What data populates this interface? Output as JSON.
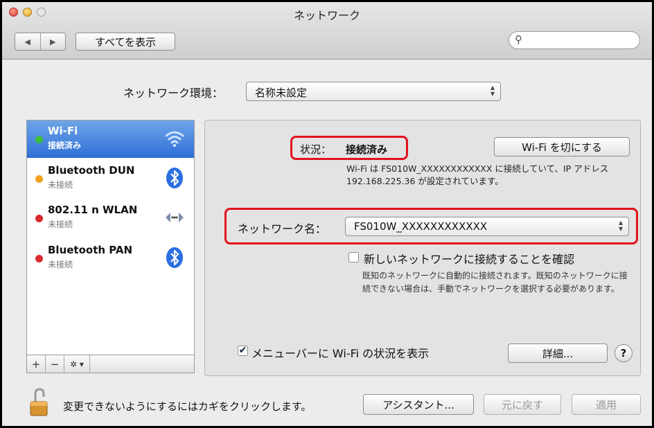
{
  "window": {
    "title": "ネットワーク"
  },
  "toolbar": {
    "back_icon": "back-arrow-icon",
    "forward_icon": "forward-arrow-icon",
    "show_all": "すべてを表示",
    "search_placeholder": "",
    "search_icon": "magnifier-icon"
  },
  "location": {
    "label": "ネットワーク環境：",
    "value": "名称未設定"
  },
  "services": [
    {
      "name": "Wi-Fi",
      "status": "接続済み",
      "dot": "#3cbd3c",
      "icon": "wifi-icon",
      "selected": true
    },
    {
      "name": "Bluetooth DUN",
      "status": "未接続",
      "dot": "#f0a21e",
      "icon": "bluetooth-icon"
    },
    {
      "name": "802.11 n WLAN",
      "status": "未接続",
      "dot": "#d92b2b",
      "icon": "ethernet-arrows-icon"
    },
    {
      "name": "Bluetooth PAN",
      "status": "未接続",
      "dot": "#d92b2b",
      "icon": "bluetooth-icon"
    }
  ],
  "sidebar_controls": {
    "add": "+",
    "remove": "−",
    "gear": "✲ ▾"
  },
  "detail": {
    "status_label": "状況：",
    "status_value": "接続済み",
    "wifi_off_button": "Wi-Fi を切にする",
    "status_desc": "Wi-Fi は FS010W_XXXXXXXXXXXX に接続していて、IP アドレス 192.168.225.36 が設定されています。",
    "network_name_label": "ネットワーク名：",
    "network_name_value": "FS010W_XXXXXXXXXXXX",
    "ask_join_label": "新しいネットワークに接続することを確認",
    "ask_join_checked": false,
    "ask_join_desc": "既知のネットワークに自動的に接続されます。既知のネットワークに接続できない場合は、手動でネットワークを選択する必要があります。",
    "menu_status_label": "メニューバーに Wi-Fi の状況を表示",
    "menu_status_checked": true,
    "advanced_button": "詳細...",
    "help_button": "?"
  },
  "footer": {
    "lock_text": "変更できないようにするにはカギをクリックします。",
    "assistant_button": "アシスタント...",
    "revert_button": "元に戻す",
    "apply_button": "適用"
  },
  "colors": {
    "highlight": "#e3111a",
    "selection": "#2d6fd6"
  }
}
